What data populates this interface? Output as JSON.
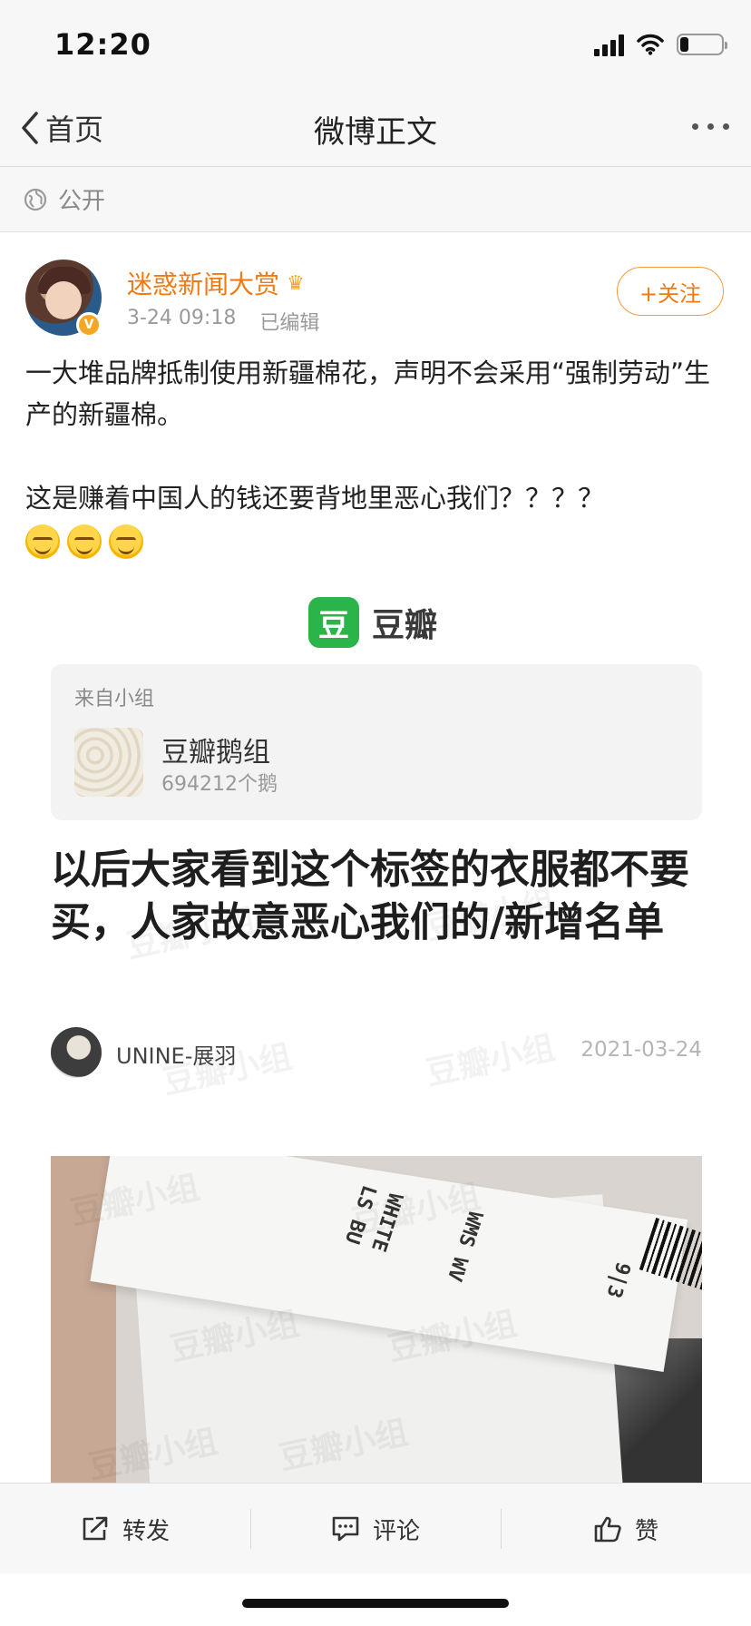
{
  "status_bar": {
    "time": "12:20",
    "battery_level": 0.2
  },
  "nav": {
    "back_label": "首页",
    "title": "微博正文"
  },
  "visibility": {
    "label": "公开"
  },
  "post": {
    "username": "迷惑新闻大赏",
    "time": "3-24 09:18",
    "edited": "已编辑",
    "follow_label": "+关注",
    "text_line1": "一大堆品牌抵制使用新疆棉花，声明不会采用“强制劳动”生产的新疆棉。",
    "text_line2": "这是赚着中国人的钱还要背地里恶心我们？？？？",
    "emoji_names": [
      "smirk-emoji",
      "smirk-emoji",
      "smirk-emoji"
    ]
  },
  "share_card": {
    "app_name": "豆瓣",
    "app_icon_char": "豆",
    "group_from": "来自小组",
    "group_name": "豆瓣鹅组",
    "group_count": "694212个鹅",
    "headline": "以后大家看到这个标签的衣服都不要买，人家故意恶心我们的/新增名单",
    "author": "UNINE-展羽",
    "date": "2021-03-24",
    "watermark": "豆瓣小组",
    "photo_texts": [
      "LS BU",
      "WHITE",
      "WMS WV",
      "9|3"
    ]
  },
  "actions": {
    "repost": "转发",
    "comment": "评论",
    "like": "赞"
  },
  "colors": {
    "accent": "#f07a14",
    "douban_green": "#2bb44a"
  }
}
